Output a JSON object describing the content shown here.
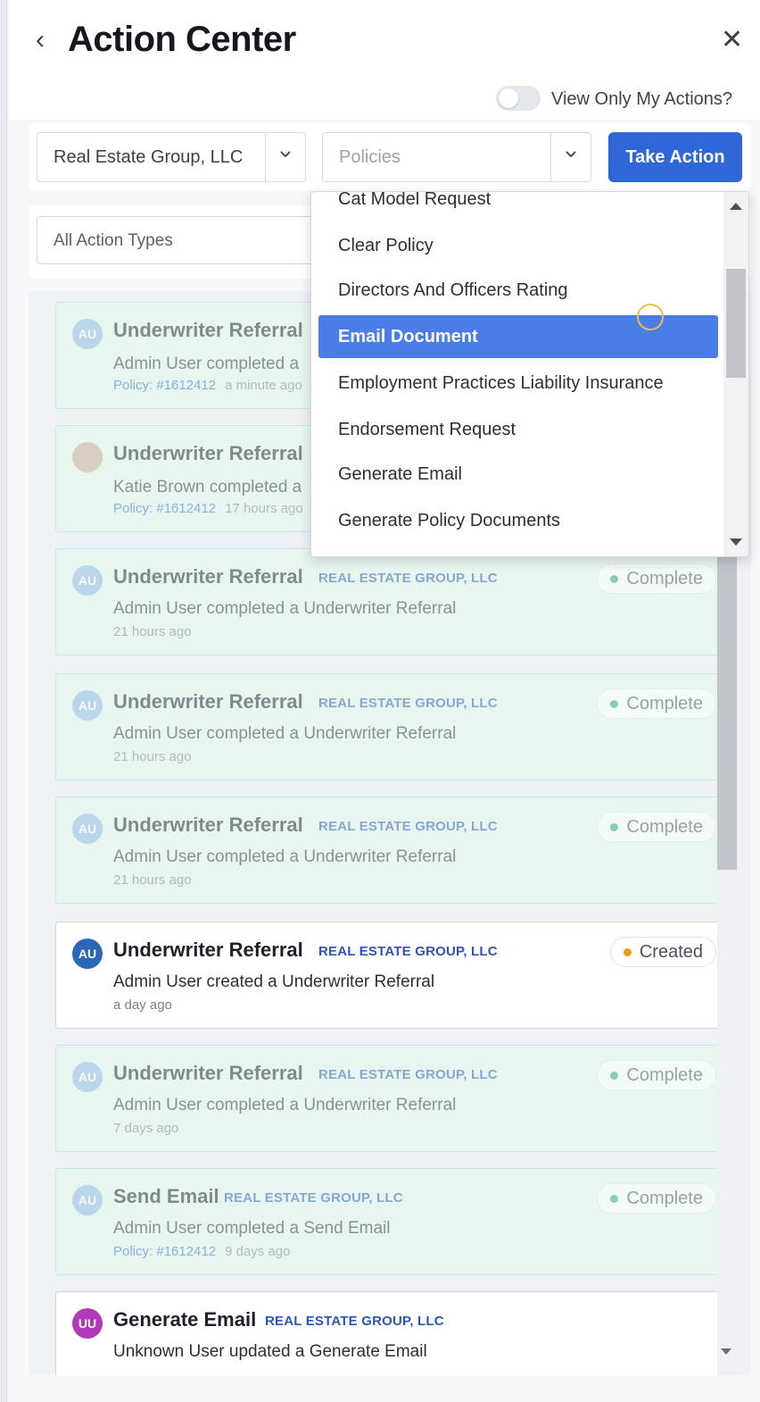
{
  "header": {
    "title": "Action Center",
    "back_icon": "chevron-left-icon",
    "close_icon": "close-icon"
  },
  "toggle": {
    "label": "View Only My Actions?",
    "checked": false
  },
  "filters": {
    "company": "Real Estate Group, LLC",
    "policies_placeholder": "Policies",
    "take_action": "Take Action",
    "action_types": "All Action Types"
  },
  "dropdown": {
    "items": [
      "Cat Model Request",
      "Clear Policy",
      "Directors And Officers Rating",
      "Email Document",
      "Employment Practices Liability Insurance",
      "Endorsement Request",
      "Generate Email",
      "Generate Policy Documents"
    ],
    "highlighted": "Email Document"
  },
  "cards": [
    {
      "avatar": "AU",
      "title": "Underwriter Referral",
      "company": "",
      "status": "",
      "desc": "Admin User completed a",
      "policy": "Policy: #1612412",
      "time": "a minute ago"
    },
    {
      "avatar": "",
      "title": "Underwriter Referral",
      "company": "",
      "status": "",
      "desc": "Katie Brown completed a",
      "policy": "Policy: #1612412",
      "time": "17 hours ago"
    },
    {
      "avatar": "AU",
      "title": "Underwriter Referral",
      "company": "REAL ESTATE GROUP, LLC",
      "status": "Complete",
      "desc": "Admin User completed a Underwriter Referral",
      "policy": "",
      "time": "21 hours ago"
    },
    {
      "avatar": "AU",
      "title": "Underwriter Referral",
      "company": "REAL ESTATE GROUP, LLC",
      "status": "Complete",
      "desc": "Admin User completed a Underwriter Referral",
      "policy": "",
      "time": "21 hours ago"
    },
    {
      "avatar": "AU",
      "title": "Underwriter Referral",
      "company": "REAL ESTATE GROUP, LLC",
      "status": "Complete",
      "desc": "Admin User completed a Underwriter Referral",
      "policy": "",
      "time": "21 hours ago"
    },
    {
      "avatar": "AU",
      "title": "Underwriter Referral",
      "company": "REAL ESTATE GROUP, LLC",
      "status": "Created",
      "desc": "Admin User created a Underwriter Referral",
      "policy": "",
      "time": "a day ago"
    },
    {
      "avatar": "AU",
      "title": "Underwriter Referral",
      "company": "REAL ESTATE GROUP, LLC",
      "status": "Complete",
      "desc": "Admin User completed a Underwriter Referral",
      "policy": "",
      "time": "7 days ago"
    },
    {
      "avatar": "AU",
      "title": "Send Email",
      "company": "REAL ESTATE GROUP, LLC",
      "status": "Complete",
      "desc": "Admin User completed a Send Email",
      "policy": "Policy: #1612412",
      "time": "9 days ago"
    },
    {
      "avatar": "UU",
      "title": "Generate Email",
      "company": "REAL ESTATE GROUP, LLC",
      "status": "",
      "desc": "Unknown User updated a Generate Email",
      "policy": "",
      "time": ""
    }
  ],
  "colors": {
    "accent": "#2f67d8",
    "highlight": "#4a7ee6",
    "complete_dot": "#2aa774",
    "created_dot": "#e79c19"
  }
}
